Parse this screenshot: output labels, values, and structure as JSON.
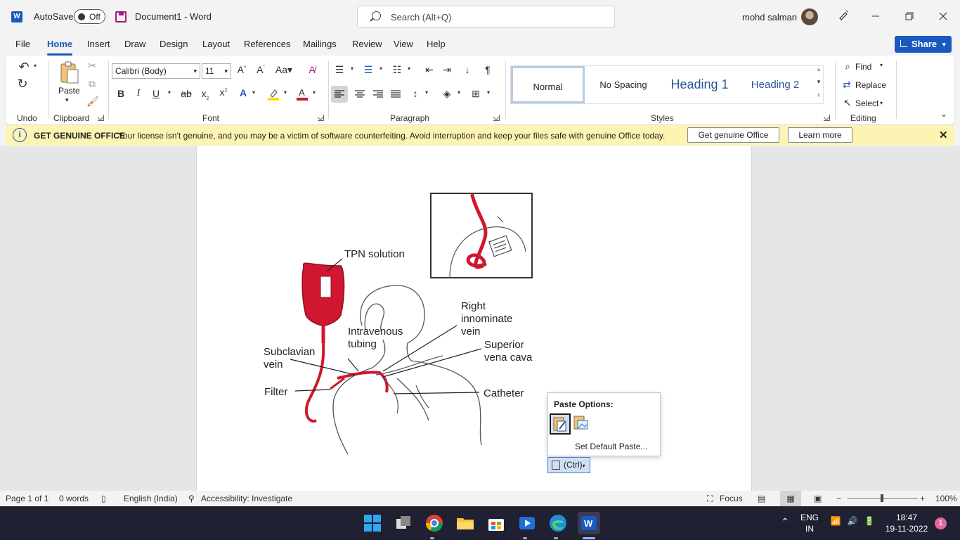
{
  "titlebar": {
    "autosave_label": "AutoSave",
    "autosave_state": "Off",
    "document_title": "Document1  -  Word",
    "search_placeholder": "Search (Alt+Q)",
    "user_name": "mohd salman"
  },
  "tabs": [
    "File",
    "Home",
    "Insert",
    "Draw",
    "Design",
    "Layout",
    "References",
    "Mailings",
    "Review",
    "View",
    "Help"
  ],
  "active_tab": "Home",
  "share_label": "Share",
  "ribbon": {
    "paste_label": "Paste",
    "font_name": "Calibri (Body)",
    "font_size": "11",
    "groups": {
      "undo": "Undo",
      "clipboard": "Clipboard",
      "font": "Font",
      "paragraph": "Paragraph",
      "styles": "Styles",
      "editing": "Editing"
    },
    "styles": [
      "Normal",
      "No Spacing",
      "Heading 1",
      "Heading 2"
    ],
    "editing": {
      "find": "Find",
      "replace": "Replace",
      "select": "Select"
    }
  },
  "notice": {
    "title": "GET GENUINE OFFICE",
    "message": "Your license isn't genuine, and you may be a victim of software counterfeiting. Avoid interruption and keep your files safe with genuine Office today.",
    "primary_button": "Get genuine Office",
    "secondary_button": "Learn more"
  },
  "figure_labels": {
    "tpn": "TPN solution",
    "right": "Right",
    "innominate": "innominate",
    "vein_r": "vein",
    "intravenous": "Intravenous",
    "tubing": "tubing",
    "superior": "Superior",
    "vena_cava": "vena cava",
    "subclavian": "Subclavian",
    "vein_s": "vein",
    "filter": "Filter",
    "catheter": "Catheter"
  },
  "paste_popup": {
    "title": "Paste Options:",
    "set_default": "Set Default Paste...",
    "ctrl_label": "(Ctrl)"
  },
  "statusbar": {
    "page": "Page 1 of 1",
    "words": "0 words",
    "language": "English (India)",
    "accessibility": "Accessibility: Investigate",
    "focus": "Focus",
    "zoom": "100%"
  },
  "tray": {
    "lang_top": "ENG",
    "lang_bottom": "IN",
    "time": "18:47",
    "date": "19-11-2022",
    "notifications": "1"
  },
  "colors": {
    "accent": "#185abd",
    "notice_bg": "#fcf4b3",
    "taskbar": "#202033",
    "figure_red": "#d0172f"
  }
}
